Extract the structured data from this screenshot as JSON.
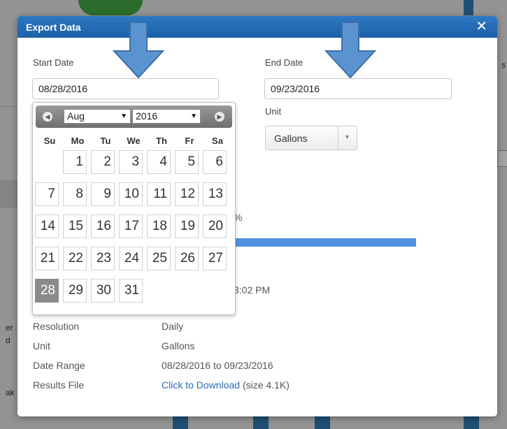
{
  "modal": {
    "title": "Export Data",
    "close_glyph": "✕"
  },
  "form": {
    "start_label": "Start Date",
    "start_value": "08/28/2016",
    "end_label": "End Date",
    "end_value": "09/23/2016",
    "unit_label": "Unit",
    "unit_value": "Gallons"
  },
  "progress": {
    "percent_suffix": "%",
    "value": 1.0,
    "time_fragment": "3:02 PM"
  },
  "details": {
    "resolution_label": "Resolution",
    "resolution_value": "Daily",
    "unit_label": "Unit",
    "unit_value": "Gallons",
    "range_label": "Date Range",
    "range_value": "08/28/2016 to 09/23/2016",
    "file_label": "Results File",
    "file_link": "Click to Download",
    "file_size": " (size 4.1K)"
  },
  "datepicker": {
    "month": "Aug",
    "year": "2016",
    "weekdays": [
      "Su",
      "Mo",
      "Tu",
      "We",
      "Th",
      "Fr",
      "Sa"
    ],
    "selected_day": "28",
    "days": [
      "1",
      "2",
      "3",
      "4",
      "5",
      "6",
      "7",
      "8",
      "9",
      "10",
      "11",
      "12",
      "13",
      "14",
      "15",
      "16",
      "17",
      "18",
      "19",
      "20",
      "21",
      "22",
      "23",
      "24",
      "25",
      "26",
      "27",
      "28",
      "29",
      "30",
      "31"
    ],
    "prev_glyph": "◀",
    "next_glyph": "▶"
  },
  "background": {
    "fragments": [
      "s",
      "er",
      "d",
      "ak"
    ]
  },
  "colors": {
    "titlebar": "#1c60a7",
    "progress": "#4f93e0",
    "link": "#2a6bb5",
    "arrow": "#5a93d0"
  }
}
